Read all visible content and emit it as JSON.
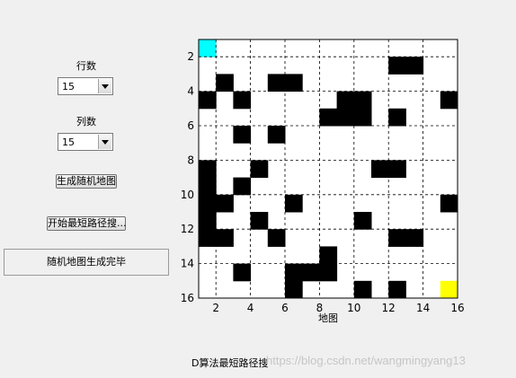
{
  "controls": {
    "rows_label": "行数",
    "rows_value": "15",
    "cols_label": "列数",
    "cols_value": "15",
    "generate_button": "生成随机地图",
    "search_button": "开始最短路径搜..."
  },
  "status_text": "随机地图生成完毕",
  "plot": {
    "xlabel": "地图",
    "x_ticks": [
      "2",
      "4",
      "6",
      "8",
      "10",
      "12",
      "14",
      "16"
    ],
    "y_ticks": [
      "2",
      "4",
      "6",
      "8",
      "10",
      "12",
      "14",
      "16"
    ],
    "rows": 15,
    "cols": 15,
    "start": {
      "row": 1,
      "col": 1
    },
    "goal": {
      "row": 15,
      "col": 15
    },
    "obstacles": [
      [
        2,
        12
      ],
      [
        2,
        13
      ],
      [
        3,
        2
      ],
      [
        3,
        5
      ],
      [
        3,
        6
      ],
      [
        4,
        1
      ],
      [
        4,
        3
      ],
      [
        4,
        9
      ],
      [
        4,
        10
      ],
      [
        4,
        15
      ],
      [
        5,
        8
      ],
      [
        5,
        9
      ],
      [
        5,
        10
      ],
      [
        5,
        12
      ],
      [
        6,
        3
      ],
      [
        6,
        5
      ],
      [
        8,
        1
      ],
      [
        8,
        4
      ],
      [
        8,
        11
      ],
      [
        8,
        12
      ],
      [
        9,
        1
      ],
      [
        9,
        3
      ],
      [
        10,
        1
      ],
      [
        10,
        2
      ],
      [
        10,
        6
      ],
      [
        10,
        15
      ],
      [
        11,
        1
      ],
      [
        11,
        4
      ],
      [
        11,
        10
      ],
      [
        12,
        1
      ],
      [
        12,
        2
      ],
      [
        12,
        5
      ],
      [
        12,
        12
      ],
      [
        12,
        13
      ],
      [
        13,
        8
      ],
      [
        14,
        3
      ],
      [
        14,
        6
      ],
      [
        14,
        7
      ],
      [
        14,
        8
      ],
      [
        15,
        6
      ],
      [
        15,
        10
      ],
      [
        15,
        12
      ]
    ],
    "colors": {
      "start": "#00ffff",
      "goal": "#ffff00",
      "obstacle": "#000000",
      "free": "#ffffff"
    }
  },
  "bottom_label": "D算法最短路径搜",
  "watermark": "https://blog.csdn.net/wangmingyang13"
}
